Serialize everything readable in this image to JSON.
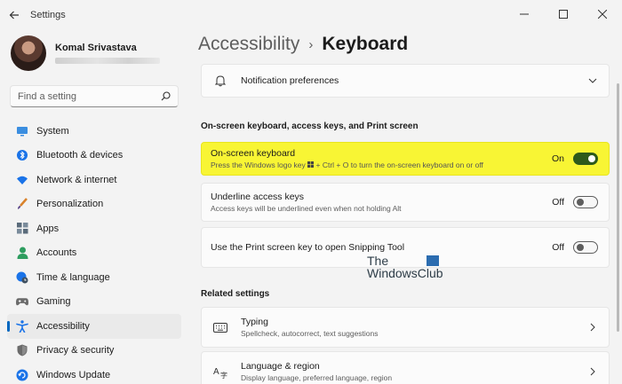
{
  "window": {
    "title": "Settings",
    "back_icon": "back-arrow-icon",
    "controls": [
      "minimize-icon",
      "maximize-icon",
      "close-icon"
    ]
  },
  "profile": {
    "name": "Komal Srivastava",
    "email": ""
  },
  "search": {
    "placeholder": "Find a setting",
    "icon": "search-icon"
  },
  "nav": {
    "items": [
      {
        "label": "System",
        "icon": "monitor-icon",
        "color": "#2a7fd4"
      },
      {
        "label": "Bluetooth & devices",
        "icon": "bluetooth-icon",
        "color": "#1a73e8"
      },
      {
        "label": "Network & internet",
        "icon": "wifi-icon",
        "color": "#1a73e8"
      },
      {
        "label": "Personalization",
        "icon": "brush-icon",
        "color": "#d9822b"
      },
      {
        "label": "Apps",
        "icon": "apps-icon",
        "color": "#5a6b7b"
      },
      {
        "label": "Accounts",
        "icon": "person-icon",
        "color": "#2e9d5f"
      },
      {
        "label": "Time & language",
        "icon": "globe-clock-icon",
        "color": "#1a73e8"
      },
      {
        "label": "Gaming",
        "icon": "gamepad-icon",
        "color": "#6b6b6b"
      },
      {
        "label": "Accessibility",
        "icon": "accessibility-icon",
        "color": "#1a73e8"
      },
      {
        "label": "Privacy & security",
        "icon": "shield-icon",
        "color": "#6b6b6b"
      },
      {
        "label": "Windows Update",
        "icon": "refresh-icon",
        "color": "#1a73e8"
      }
    ],
    "active_index": 8
  },
  "breadcrumb": {
    "parent": "Accessibility",
    "separator": "›",
    "current": "Keyboard"
  },
  "notification": {
    "title": "Notification preferences",
    "icon": "bell-icon"
  },
  "section1": {
    "title": "On-screen keyboard, access keys, and Print screen"
  },
  "osk": {
    "title": "On-screen keyboard",
    "desc_prefix": "Press the Windows logo key",
    "desc_suffix": "+ Ctrl + O to turn the on-screen keyboard on or off",
    "state": "On",
    "highlight_color": "#f8f534"
  },
  "underline": {
    "title": "Underline access keys",
    "desc": "Access keys will be underlined even when not holding Alt",
    "state": "Off"
  },
  "printscreen": {
    "title": "Use the Print screen key to open Snipping Tool",
    "state": "Off"
  },
  "watermark": {
    "line1": "The",
    "line2": "WindowsClub"
  },
  "section2": {
    "title": "Related settings"
  },
  "typing": {
    "title": "Typing",
    "desc": "Spellcheck, autocorrect, text suggestions",
    "icon": "keyboard-icon"
  },
  "language": {
    "title": "Language & region",
    "desc": "Display language, preferred language, region",
    "icon": "language-icon"
  },
  "colors": {
    "accent": "#0067c0",
    "toggle_on": "#2d5a1b"
  }
}
